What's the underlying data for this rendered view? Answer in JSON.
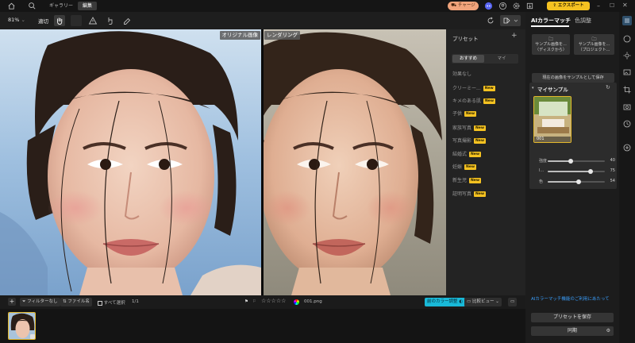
{
  "top": {
    "tabs": [
      "ギャラリー",
      "編集"
    ],
    "active_tab": "編集",
    "charge_label": "チャージ",
    "export_label": "エクスポート"
  },
  "toolbar": {
    "zoom": "81%",
    "fit_label": "適切"
  },
  "canvas": {
    "original_label": "オリジナル画像",
    "render_label": "レンダリング"
  },
  "presets": {
    "title": "プリセット",
    "seg_recommended": "おすすめ",
    "seg_mine": "マイ",
    "items": [
      {
        "label": "効果なし",
        "new": false
      },
      {
        "label": "クリーミー...",
        "new": true
      },
      {
        "label": "キメのある肌",
        "new": true
      },
      {
        "label": "子供",
        "new": true
      },
      {
        "label": "家族写真",
        "new": true
      },
      {
        "label": "写真撮影",
        "new": true
      },
      {
        "label": "結婚式",
        "new": true
      },
      {
        "label": "妊娠",
        "new": true
      },
      {
        "label": "新生児",
        "new": true
      },
      {
        "label": "証明写真",
        "new": true
      }
    ],
    "new_badge": "New"
  },
  "right": {
    "tab_ai": "AIカラーマッチ",
    "tab_color": "色調整",
    "sample_disk_1": "サンプル画像を...",
    "sample_disk_2": "（ディスクから）",
    "sample_project_1": "サンプル画像を...",
    "sample_project_2": "（プロジェクト...",
    "save_current": "現在の画像をサンプルとして保存",
    "my_sample": "マイサンプル",
    "sample_name": "001",
    "sliders": [
      {
        "label": "強度",
        "value": 40
      },
      {
        "label": "I...",
        "value": 75
      },
      {
        "label": "色",
        "value": 54
      }
    ],
    "help_link": "AIカラーマッチ機能のご利用にあたって",
    "save_preset": "プリセットを保存",
    "sync": "同期"
  },
  "bottom": {
    "filter_label": "フィルターなし",
    "filename_label": "ファイル名",
    "select_all": "すべて選択",
    "count": "1/1",
    "stars": "☆☆☆☆☆",
    "file_name": "001.png",
    "compare_label": "前のカラー調整",
    "view_label": "比較ビュー"
  },
  "colors": {
    "accent_yellow": "#f5c221",
    "charge_orange": "#f0a37b",
    "link_blue": "#3aa0ff",
    "toggle_cyan": "#19b9d8"
  }
}
